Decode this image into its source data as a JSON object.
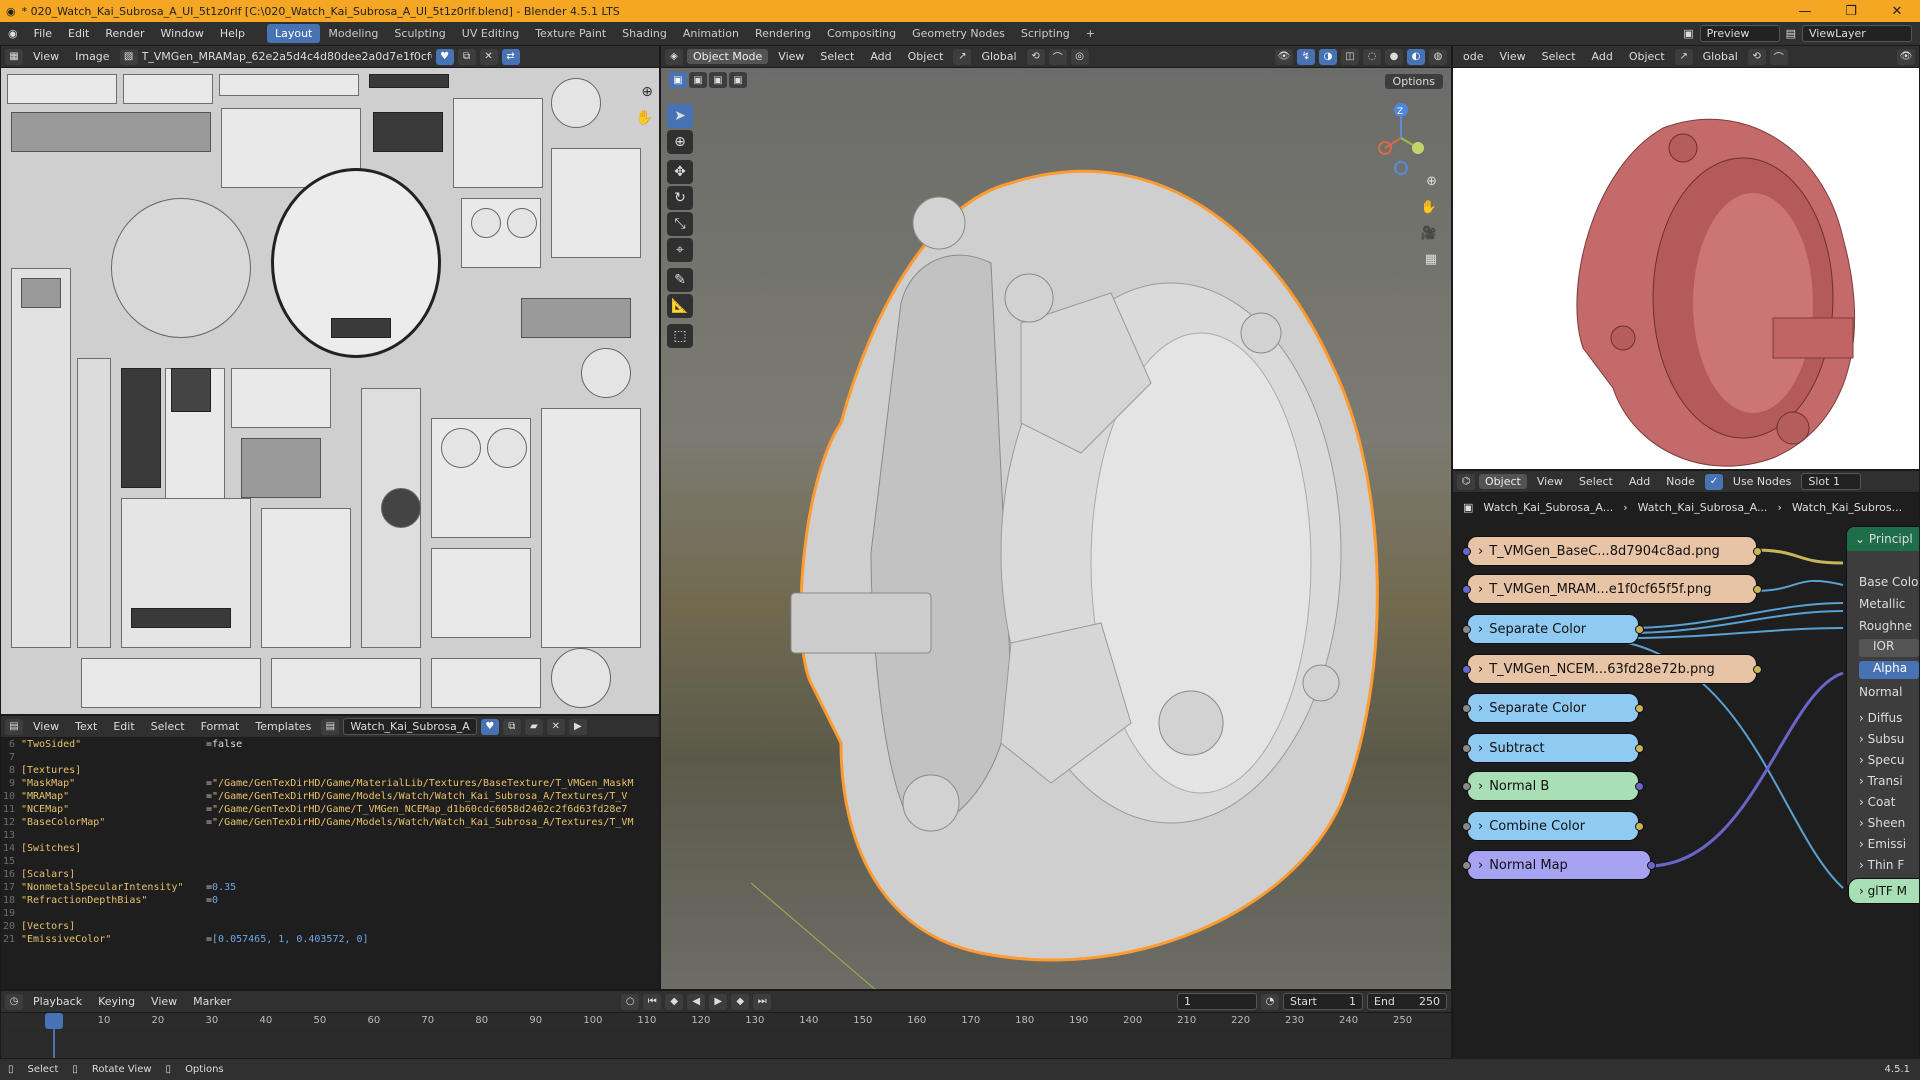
{
  "window": {
    "title": "* 020_Watch_Kai_Subrosa_A_UI_5t1z0rlf [C:\\020_Watch_Kai_Subrosa_A_UI_5t1z0rlf.blend] - Blender 4.5.1 LTS",
    "buttons": [
      "—",
      "❐",
      "✕"
    ]
  },
  "topbar": {
    "menus": [
      "File",
      "Edit",
      "Render",
      "Window",
      "Help"
    ],
    "workspaces": [
      "Layout",
      "Modeling",
      "Sculpting",
      "UV Editing",
      "Texture Paint",
      "Shading",
      "Animation",
      "Rendering",
      "Compositing",
      "Geometry Nodes",
      "Scripting"
    ],
    "add_tab": "+",
    "scene": "Preview",
    "view_layer": "ViewLayer"
  },
  "uv_editor": {
    "menus": [
      "View",
      "Image"
    ],
    "image_name": "T_VMGen_MRAMap_62e2a5d4c4d80dee2a0d7e1f0cf65..."
  },
  "text_editor": {
    "menus": [
      "View",
      "Text",
      "Edit",
      "Select",
      "Format",
      "Templates"
    ],
    "text_name": "Watch_Kai_Subrosa_A",
    "lines": [
      {
        "n": "6",
        "k": "\"TwoSided\"",
        "eq": "= ",
        "v": "false",
        "vt": "plain"
      },
      {
        "n": "7",
        "k": "",
        "eq": "",
        "v": "",
        "vt": "plain"
      },
      {
        "n": "8",
        "k": "[Textures]",
        "eq": "",
        "v": "",
        "vt": "plain"
      },
      {
        "n": "9",
        "k": "\"MaskMap\"",
        "eq": "= ",
        "v": "\"/Game/GenTexDirHD/Game/MaterialLib/Textures/BaseTexture/T_VMGen_MaskM",
        "vt": "str"
      },
      {
        "n": "10",
        "k": "\"MRAMap\"",
        "eq": "= ",
        "v": "\"/Game/GenTexDirHD/Game/Models/Watch/Watch_Kai_Subrosa_A/Textures/T_V",
        "vt": "str"
      },
      {
        "n": "11",
        "k": "\"NCEMap\"",
        "eq": "= ",
        "v": "\"/Game/GenTexDirHD/Game/T_VMGen_NCEMap_d1b60cdc6058d2402c2f6d63fd28e7",
        "vt": "str"
      },
      {
        "n": "12",
        "k": "\"BaseColorMap\"",
        "eq": "= ",
        "v": "\"/Game/GenTexDirHD/Game/Models/Watch/Watch_Kai_Subrosa_A/Textures/T_VM",
        "vt": "str"
      },
      {
        "n": "13",
        "k": "",
        "eq": "",
        "v": "",
        "vt": "plain"
      },
      {
        "n": "14",
        "k": "[Switches]",
        "eq": "",
        "v": "",
        "vt": "plain"
      },
      {
        "n": "15",
        "k": "",
        "eq": "",
        "v": "",
        "vt": "plain"
      },
      {
        "n": "16",
        "k": "[Scalars]",
        "eq": "",
        "v": "",
        "vt": "plain"
      },
      {
        "n": "17",
        "k": "\"NonmetalSpecularIntensity\"",
        "eq": "= ",
        "v": "0.35",
        "vt": "num"
      },
      {
        "n": "18",
        "k": "\"RefractionDepthBias\"",
        "eq": "= ",
        "v": "0",
        "vt": "num"
      },
      {
        "n": "19",
        "k": "",
        "eq": "",
        "v": "",
        "vt": "plain"
      },
      {
        "n": "20",
        "k": "[Vectors]",
        "eq": "",
        "v": "",
        "vt": "plain"
      },
      {
        "n": "21",
        "k": "\"EmissiveColor\"",
        "eq": "= ",
        "v": "[0.057465, 1, 0.403572, 0]",
        "vt": "num"
      }
    ]
  },
  "viewport": {
    "mode": "Object Mode",
    "menus": [
      "View",
      "Select",
      "Add",
      "Object"
    ],
    "orientation": "Global",
    "options": "Options",
    "gizmo_axis": "Z"
  },
  "preview_editor": {
    "editor_label": "ode",
    "menus": [
      "View",
      "Select",
      "Add",
      "Object"
    ],
    "orientation": "Global"
  },
  "node_editor": {
    "object": "Object",
    "menus": [
      "View",
      "Select",
      "Add",
      "Node"
    ],
    "use_nodes": "Use Nodes",
    "slot": "Slot 1",
    "breadcrumbs": [
      "Watch_Kai_Subrosa_A...",
      "Watch_Kai_Subrosa_A...",
      "Watch_Kai_Subros..."
    ],
    "nodes": [
      {
        "id": "basecolor-node",
        "label": "T_VMGen_BaseC...8d7904c8ad.png",
        "kind": "img"
      },
      {
        "id": "mra-node",
        "label": "T_VMGen_MRAM...e1f0cf65f5f.png",
        "kind": "img"
      },
      {
        "id": "separate-color-1",
        "label": "Separate Color",
        "kind": "conv"
      },
      {
        "id": "nce-node",
        "label": "T_VMGen_NCEM...63fd28e72b.png",
        "kind": "img"
      },
      {
        "id": "separate-color-2",
        "label": "Separate Color",
        "kind": "conv"
      },
      {
        "id": "subtract-node",
        "label": "Subtract",
        "kind": "conv"
      },
      {
        "id": "normal-b-node",
        "label": "Normal B",
        "kind": "vec"
      },
      {
        "id": "combine-color-node",
        "label": "Combine Color",
        "kind": "conv"
      },
      {
        "id": "normal-map-node",
        "label": "Normal Map",
        "kind": "nm"
      }
    ],
    "principled": {
      "title": "Principl",
      "inputs": [
        "Base Colo",
        "Metallic",
        "Roughne",
        "IOR",
        "Alpha",
        "Normal"
      ],
      "panels": [
        "Diffus",
        "Subsu",
        "Specu",
        "Transi",
        "Coat",
        "Sheen",
        "Emissi",
        "Thin F"
      ]
    },
    "gltf_node": "glTF M"
  },
  "timeline": {
    "menus": [
      "Playback",
      "Keying",
      "View",
      "Marker"
    ],
    "current_frame": "1",
    "start_label": "Start",
    "start": "1",
    "end_label": "End",
    "end": "250",
    "ticks": [
      "1",
      "10",
      "20",
      "30",
      "40",
      "50",
      "60",
      "70",
      "80",
      "90",
      "100",
      "110",
      "120",
      "130",
      "140",
      "150",
      "160",
      "170",
      "180",
      "190",
      "200",
      "210",
      "220",
      "230",
      "240",
      "250"
    ]
  },
  "status": {
    "items": [
      "Select",
      "Rotate View",
      "Options"
    ],
    "version": "4.5.1"
  },
  "colors": {
    "title_bg": "#f5a623",
    "accent": "#4772b3",
    "preview_model": "#c46a6a",
    "selection_outline": "#ff9b30"
  }
}
